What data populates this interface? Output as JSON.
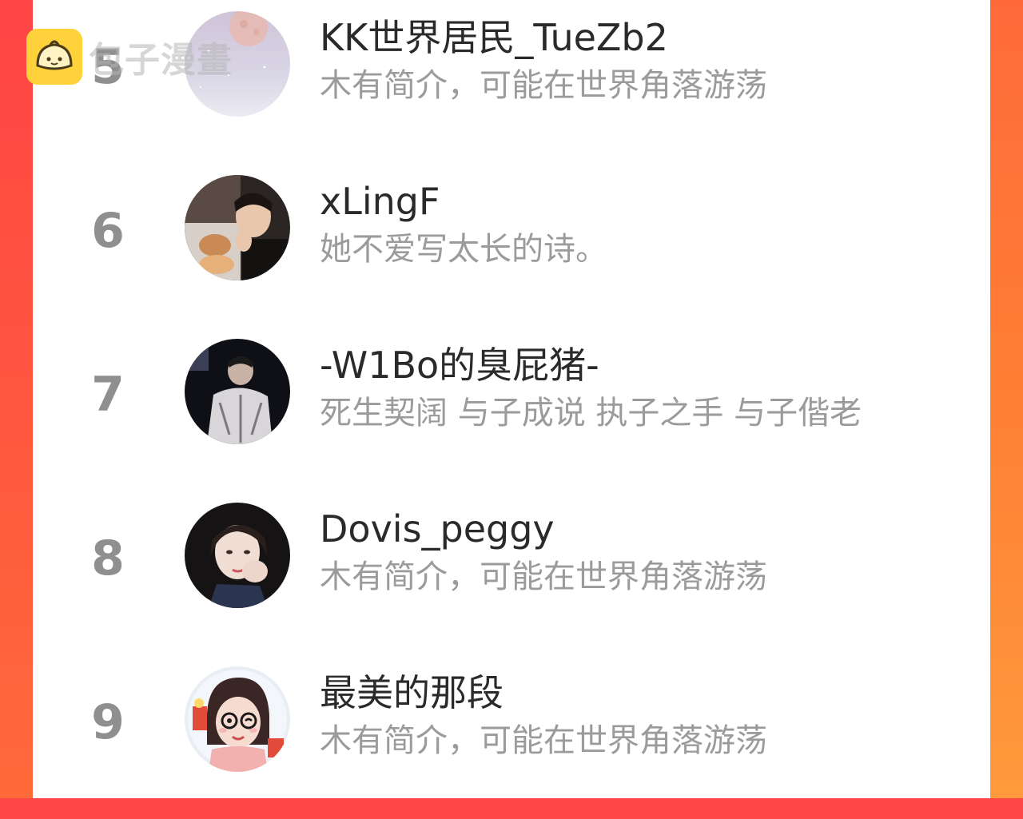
{
  "watermark": {
    "text": "包子漫畫",
    "logo_color": "#ffd23b"
  },
  "colors": {
    "accent_left": "#ff4545",
    "accent_right": "#ff8a3a",
    "rank_color": "#8f8f8f",
    "name_color": "#2a2a2a",
    "bio_color": "#9b9b9b"
  },
  "ranking": [
    {
      "rank": "5",
      "name": "KK世界居民_TueZb2",
      "bio": "木有简介，可能在世界角落游荡",
      "avatar": "moon-sky-avatar"
    },
    {
      "rank": "6",
      "name": "xLingF",
      "bio": "她不爱写太长的诗。",
      "avatar": "man-with-dog-avatar"
    },
    {
      "rank": "7",
      "name": "-W1Bo的臭屁猪-",
      "bio": "死生契阔 与子成说 执子之手 与子偕老",
      "avatar": "man-dark-stage-avatar"
    },
    {
      "rank": "8",
      "name": "Dovis_peggy",
      "bio": "木有简介，可能在世界角落游荡",
      "avatar": "woman-portrait-avatar"
    },
    {
      "rank": "9",
      "name": "最美的那段",
      "bio": "木有简介，可能在世界角落游荡",
      "avatar": "cartoon-girl-avatar"
    }
  ]
}
